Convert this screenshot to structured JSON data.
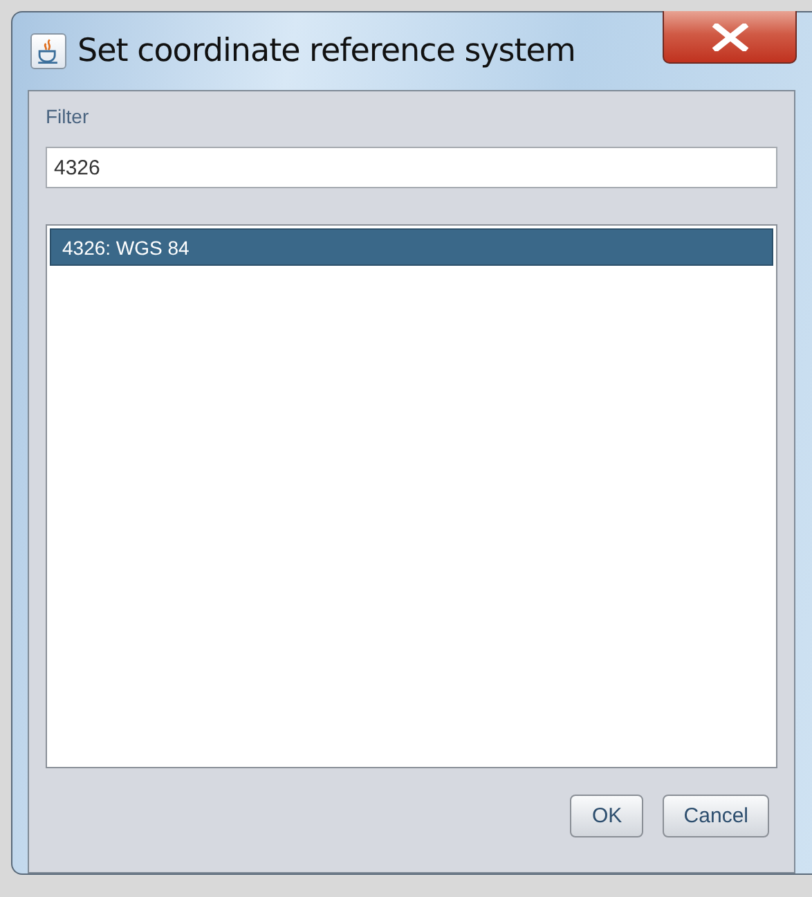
{
  "window": {
    "title": "Set coordinate reference system"
  },
  "filter": {
    "label": "Filter",
    "value": "4326"
  },
  "list": [
    {
      "label": "4326: WGS 84",
      "selected": true
    }
  ],
  "buttons": [
    "OK",
    "Cancel"
  ]
}
